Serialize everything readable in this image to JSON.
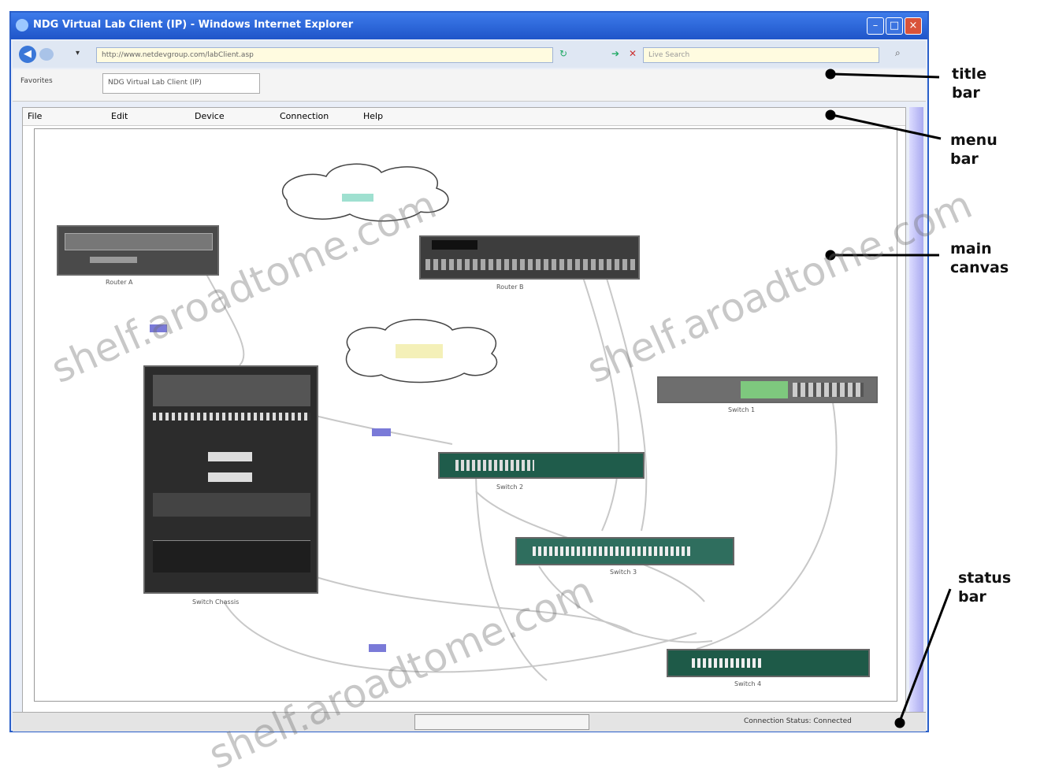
{
  "window": {
    "title": "NDG Virtual Lab Client (IP) - Windows Internet Explorer",
    "address": "http://www.netdevgroup.com/labClient.asp",
    "search_placeholder": "Live Search",
    "favorites": "Favorites",
    "tab": "NDG Virtual Lab Client (IP)"
  },
  "menu": {
    "items": [
      "File",
      "Edit",
      "Device",
      "Connection",
      "Help"
    ]
  },
  "status": {
    "text": "Connection Status: Connected"
  },
  "annotations": {
    "title_bar": "title\nbar",
    "menu_bar": "menu\nbar",
    "main_canvas": "main\ncanvas",
    "status_bar": "status\nbar"
  },
  "devices": {
    "router_a": "Router A",
    "router_b": "Router B",
    "switch_1": "Switch 1",
    "switch_2": "Switch 2",
    "switch_3": "Switch 3",
    "switch_4": "Switch 4",
    "chassis": "Switch Chassis"
  },
  "watermark": "shelf.aroadtome.com"
}
